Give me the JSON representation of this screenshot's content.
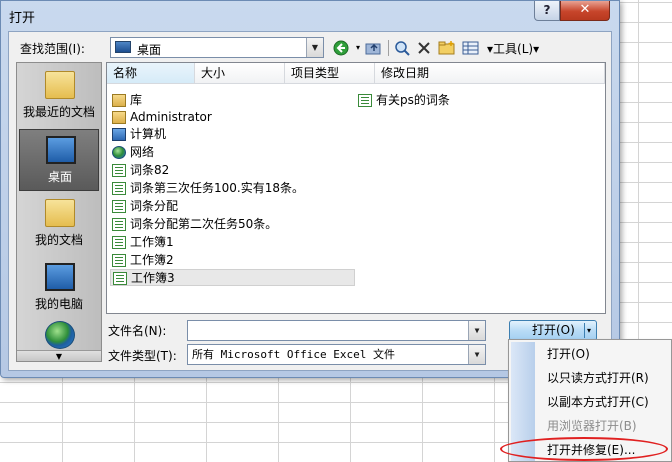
{
  "dialog": {
    "title": "打开",
    "help_glyph": "?",
    "close_glyph": "✕"
  },
  "lookin": {
    "label": "查找范围(I):",
    "value": "桌面",
    "tools_label": "▾工具(L)▾"
  },
  "toolbar_icons": [
    "back-icon",
    "up-folder-icon",
    "search-web-icon",
    "delete-icon",
    "new-folder-icon",
    "views-icon"
  ],
  "places": [
    {
      "label": "我最近的文档",
      "icon": "recent-folder-icon"
    },
    {
      "label": "桌面",
      "icon": "desktop-icon"
    },
    {
      "label": "我的文档",
      "icon": "documents-folder-icon"
    },
    {
      "label": "我的电脑",
      "icon": "computer-icon"
    },
    {
      "label": "",
      "icon": "network-globe-icon"
    }
  ],
  "columns": [
    "名称",
    "大小",
    "项目类型",
    "修改日期"
  ],
  "files": [
    {
      "name": "库",
      "icon": "library-icon"
    },
    {
      "name": "Administrator",
      "icon": "user-folder-icon"
    },
    {
      "name": "计算机",
      "icon": "computer-icon"
    },
    {
      "name": "网络",
      "icon": "network-icon"
    },
    {
      "name": "词条82",
      "icon": "excel-file-icon"
    },
    {
      "name": "词条第三次任务100.实有18条。",
      "icon": "excel-file-icon"
    },
    {
      "name": "词条分配",
      "icon": "excel-file-icon"
    },
    {
      "name": "词条分配第二次任务50条。",
      "icon": "excel-file-icon"
    },
    {
      "name": "工作簿1",
      "icon": "excel-file-icon"
    },
    {
      "name": "工作簿2",
      "icon": "excel-file-icon"
    },
    {
      "name": "工作簿3",
      "icon": "excel-file-icon"
    },
    {
      "name": "有关ps的词条",
      "icon": "excel-file-icon"
    }
  ],
  "filename": {
    "label": "文件名(N):",
    "value": ""
  },
  "filetype": {
    "label": "文件类型(T):",
    "value": "所有 Microsoft Office Excel 文件"
  },
  "open_button": {
    "label": "打开(O)",
    "arrow": "▾"
  },
  "open_menu": [
    {
      "label": "打开(O)",
      "enabled": true
    },
    {
      "label": "以只读方式打开(R)",
      "enabled": true
    },
    {
      "label": "以副本方式打开(C)",
      "enabled": true
    },
    {
      "label": "用浏览器打开(B)",
      "enabled": false
    },
    {
      "label": "打开并修复(E)...",
      "enabled": true
    }
  ],
  "colors": {
    "highlight_circle": "#e02020",
    "title_gradient": "#c9d9ee"
  }
}
